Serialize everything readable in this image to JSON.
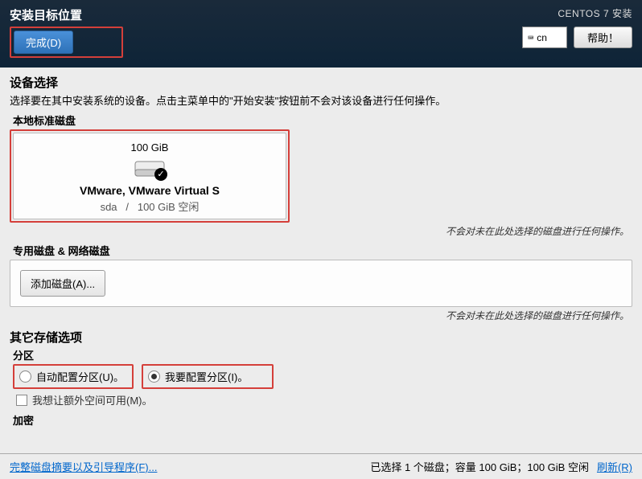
{
  "header": {
    "page_title": "安装目标位置",
    "done_button": "完成(D)",
    "installer_title": "CENTOS 7 安装",
    "keyboard_layout": "cn",
    "help_button": "帮助！"
  },
  "device_selection": {
    "heading": "设备选择",
    "description": "选择要在其中安装系统的设备。点击主菜单中的\"开始安装\"按钮前不会对该设备进行任何操作。",
    "local_disks_label": "本地标准磁盘",
    "disk": {
      "size": "100 GiB",
      "name": "VMware, VMware Virtual S",
      "device": "sda",
      "sep": "/",
      "free": "100 GiB 空闲",
      "selected": true
    },
    "note": "不会对未在此处选择的磁盘进行任何操作。",
    "special_disks_label": "专用磁盘 & 网络磁盘",
    "add_disk_button": "添加磁盘(A)..."
  },
  "storage_options": {
    "heading": "其它存储选项",
    "partition_label": "分区",
    "auto_partition": "自动配置分区(U)。",
    "manual_partition": "我要配置分区(I)。",
    "manual_selected": true,
    "extra_space": "我想让额外空间可用(M)。",
    "encrypt_label": "加密"
  },
  "footer": {
    "summary_link": "完整磁盘摘要以及引导程序(F)...",
    "status": "已选择 1 个磁盘；容量 100 GiB；100 GiB 空闲",
    "refresh_link": "刷新(R)"
  }
}
